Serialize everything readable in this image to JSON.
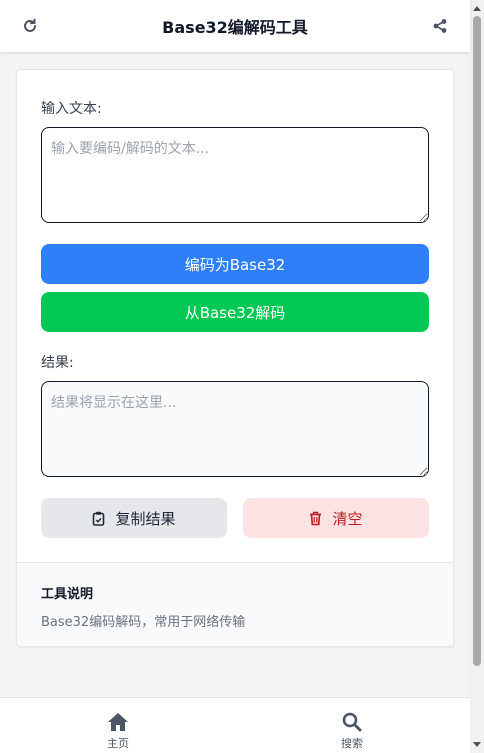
{
  "header": {
    "title": "Base32编解码工具",
    "left_icon": "refresh-icon",
    "right_icon": "share-icon"
  },
  "input": {
    "label": "输入文本:",
    "placeholder": "输入要编码/解码的文本...",
    "value": ""
  },
  "actions": {
    "encode_label": "编码为Base32",
    "decode_label": "从Base32解码",
    "encode_color": "#2f80f8",
    "decode_color": "#00c853"
  },
  "result": {
    "label": "结果:",
    "placeholder": "结果将显示在这里...",
    "value": ""
  },
  "result_actions": {
    "copy_label": "复制结果",
    "clear_label": "清空",
    "copy_icon": "clipboard-icon",
    "clear_icon": "trash-icon"
  },
  "info": {
    "title": "工具说明",
    "description": "Base32编码解码，常用于网络传输"
  },
  "bottom_nav": {
    "items": [
      {
        "label": "主页",
        "icon": "home-icon"
      },
      {
        "label": "搜索",
        "icon": "search-icon"
      }
    ]
  }
}
